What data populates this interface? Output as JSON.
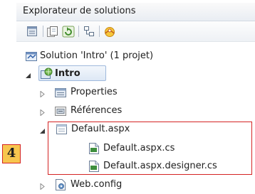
{
  "panel": {
    "title": "Explorateur de solutions"
  },
  "toolbar": {
    "buttons": [
      {
        "icon": "properties-icon"
      },
      {
        "icon": "show-all-files-icon"
      },
      {
        "icon": "refresh-icon"
      },
      {
        "icon": "view-class-diagram-icon"
      },
      {
        "icon": "copy-website-icon"
      }
    ]
  },
  "tree": {
    "solution": "Solution 'Intro' (1 projet)",
    "project": "Intro",
    "properties": "Properties",
    "references": "Références",
    "default_aspx": "Default.aspx",
    "default_aspx_cs": "Default.aspx.cs",
    "default_designer_cs": "Default.aspx.designer.cs",
    "web_config": "Web.config"
  },
  "annotation": {
    "badge_number": "4",
    "highlight_color": "#d42424",
    "badge_color": "#f7c64e"
  }
}
